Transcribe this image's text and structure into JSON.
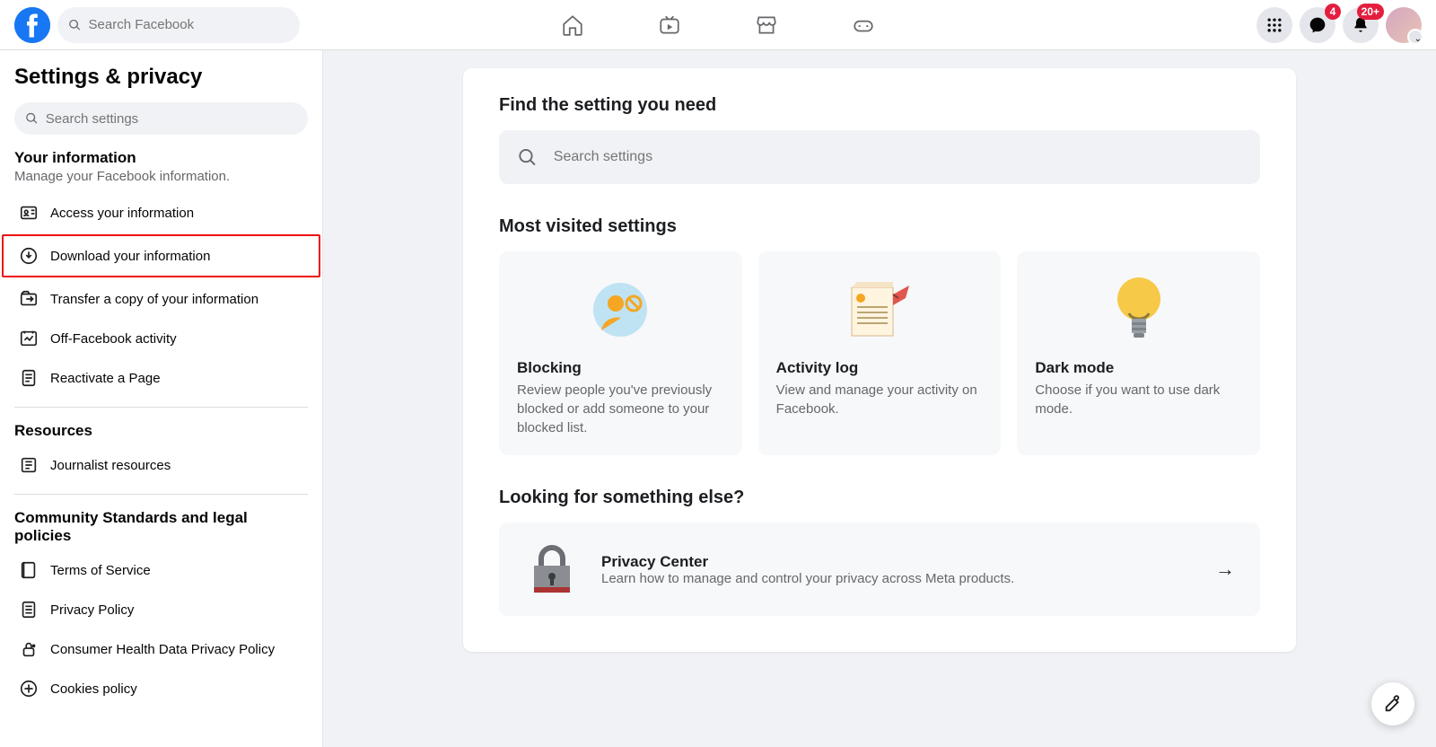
{
  "header": {
    "search_placeholder": "Search Facebook",
    "badges": {
      "messenger": "4",
      "notifications": "20+"
    }
  },
  "sidebar": {
    "title": "Settings & privacy",
    "search_placeholder": "Search settings",
    "sections": {
      "your_info": {
        "heading": "Your information",
        "sub": "Manage your Facebook information.",
        "items": [
          "Access your information",
          "Download your information",
          "Transfer a copy of your information",
          "Off-Facebook activity",
          "Reactivate a Page"
        ]
      },
      "resources": {
        "heading": "Resources",
        "items": [
          "Journalist resources"
        ]
      },
      "legal": {
        "heading": "Community Standards and legal policies",
        "items": [
          "Terms of Service",
          "Privacy Policy",
          "Consumer Health Data Privacy Policy",
          "Cookies policy"
        ]
      }
    }
  },
  "main": {
    "find_heading": "Find the setting you need",
    "big_search_placeholder": "Search settings",
    "most_visited_heading": "Most visited settings",
    "cards": [
      {
        "title": "Blocking",
        "desc": "Review people you've previously blocked or add someone to your blocked list."
      },
      {
        "title": "Activity log",
        "desc": "View and manage your activity on Facebook."
      },
      {
        "title": "Dark mode",
        "desc": "Choose if you want to use dark mode."
      }
    ],
    "looking_heading": "Looking for something else?",
    "privacy_center": {
      "title": "Privacy Center",
      "desc": "Learn how to manage and control your privacy across Meta products."
    }
  }
}
